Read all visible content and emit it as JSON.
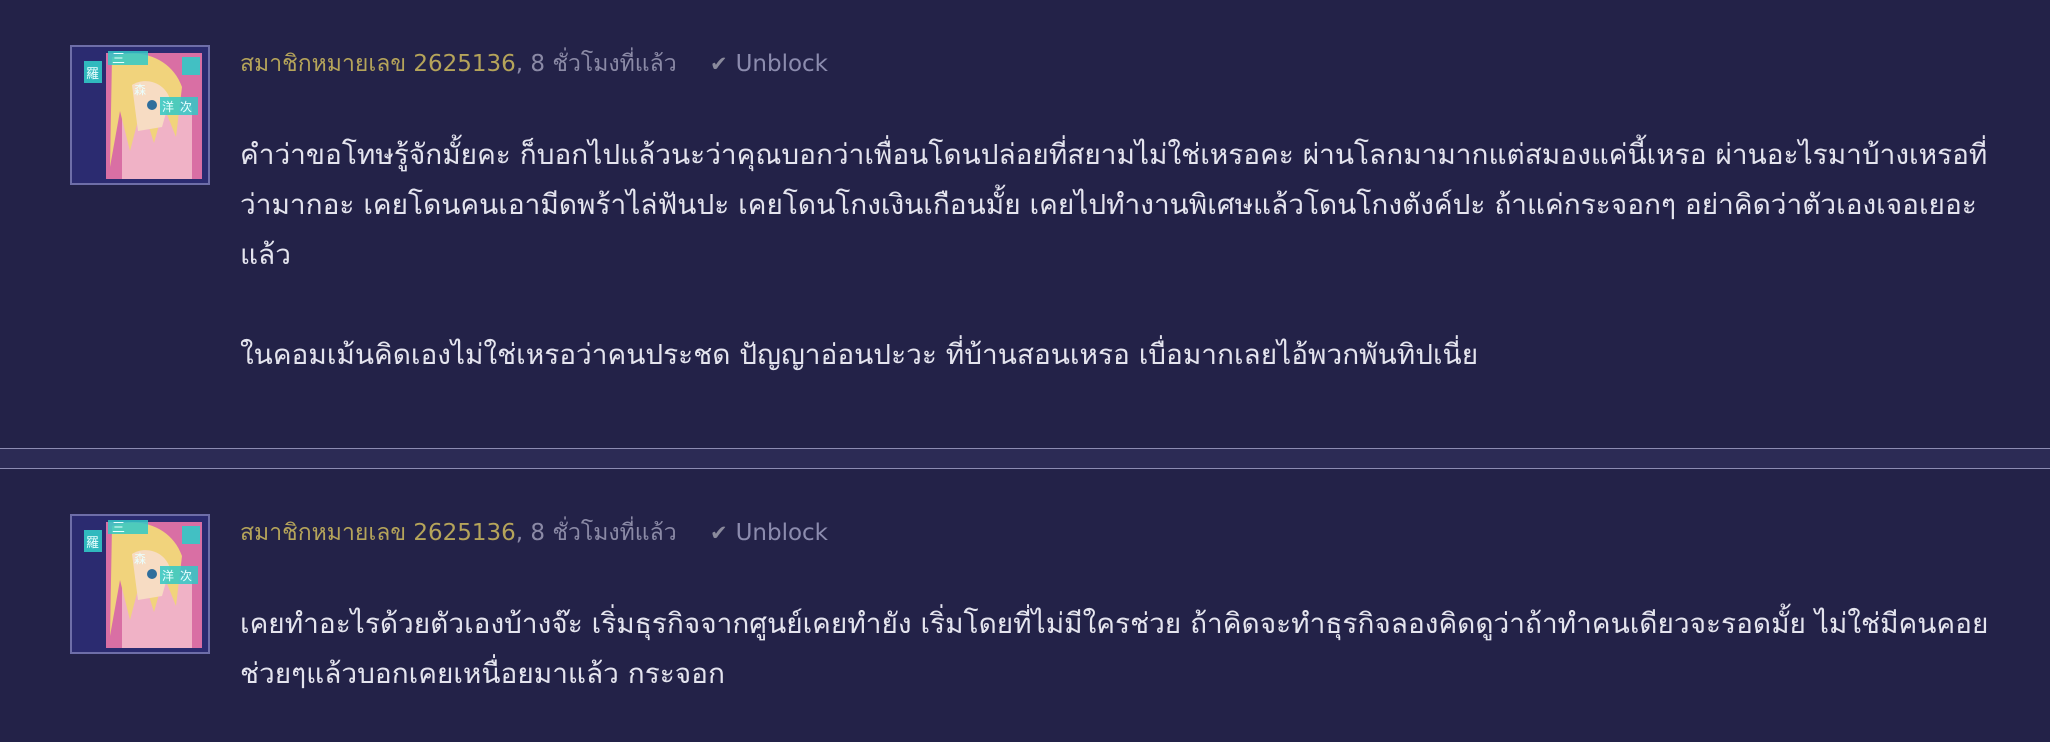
{
  "comments": [
    {
      "author": "สมาชิกหมายเลข 2625136",
      "time": ", 8 ชั่วโมงที่แล้ว",
      "unblock_label": "Unblock",
      "paragraphs": [
        "คำว่าขอโทษรู้จักมั้ยคะ ก็บอกไปแล้วนะว่าคุณบอกว่าเพื่อนโดนปล่อยที่สยามไม่ใช่เหรอคะ ผ่านโลกมามากแต่สมองแค่นี้เหรอ ผ่านอะไรมาบ้างเหรอที่ว่ามากอะ เคยโดนคนเอามีดพร้าไล่ฟันปะ เคยโดนโกงเงินเกือนมั้ย เคยไปทำงานพิเศษแล้วโดนโกงตังค์ปะ ถ้าแค่กระจอกๆ อย่าคิดว่าตัวเองเจอเยอะแล้ว",
        "ในคอมเม้นคิดเองไม่ใช่เหรอว่าคนประชด ปัญญาอ่อนปะวะ ที่บ้านสอนเหรอ เบื่อมากเลยไอ้พวกพันทิปเนี่ย"
      ]
    },
    {
      "author": "สมาชิกหมายเลข 2625136",
      "time": ", 8 ชั่วโมงที่แล้ว",
      "unblock_label": "Unblock",
      "paragraphs": [
        "เคยทำอะไรด้วยตัวเองบ้างจ๊ะ เริ่มธุรกิจจากศูนย์เคยทำยัง เริ่มโดยที่ไม่มีใครช่วย ถ้าคิดจะทำธุรกิจลองคิดดูว่าถ้าทำคนเดียวจะรอดมั้ย ไม่ใช่มีคนคอยช่วยๆแล้วบอกเคยเหนื่อยมาแล้ว กระจอก"
      ]
    }
  ],
  "avatar": {
    "kanji": [
      "三",
      "Ⅲ",
      "ｪ",
      "羅",
      "森",
      "田",
      "洋",
      "次"
    ]
  },
  "icons": {
    "unblock": "check-icon"
  },
  "colors": {
    "background": "#232248",
    "author": "#b5a45a",
    "body_text": "#e4e4ee",
    "unblock": "#8c8cae"
  }
}
